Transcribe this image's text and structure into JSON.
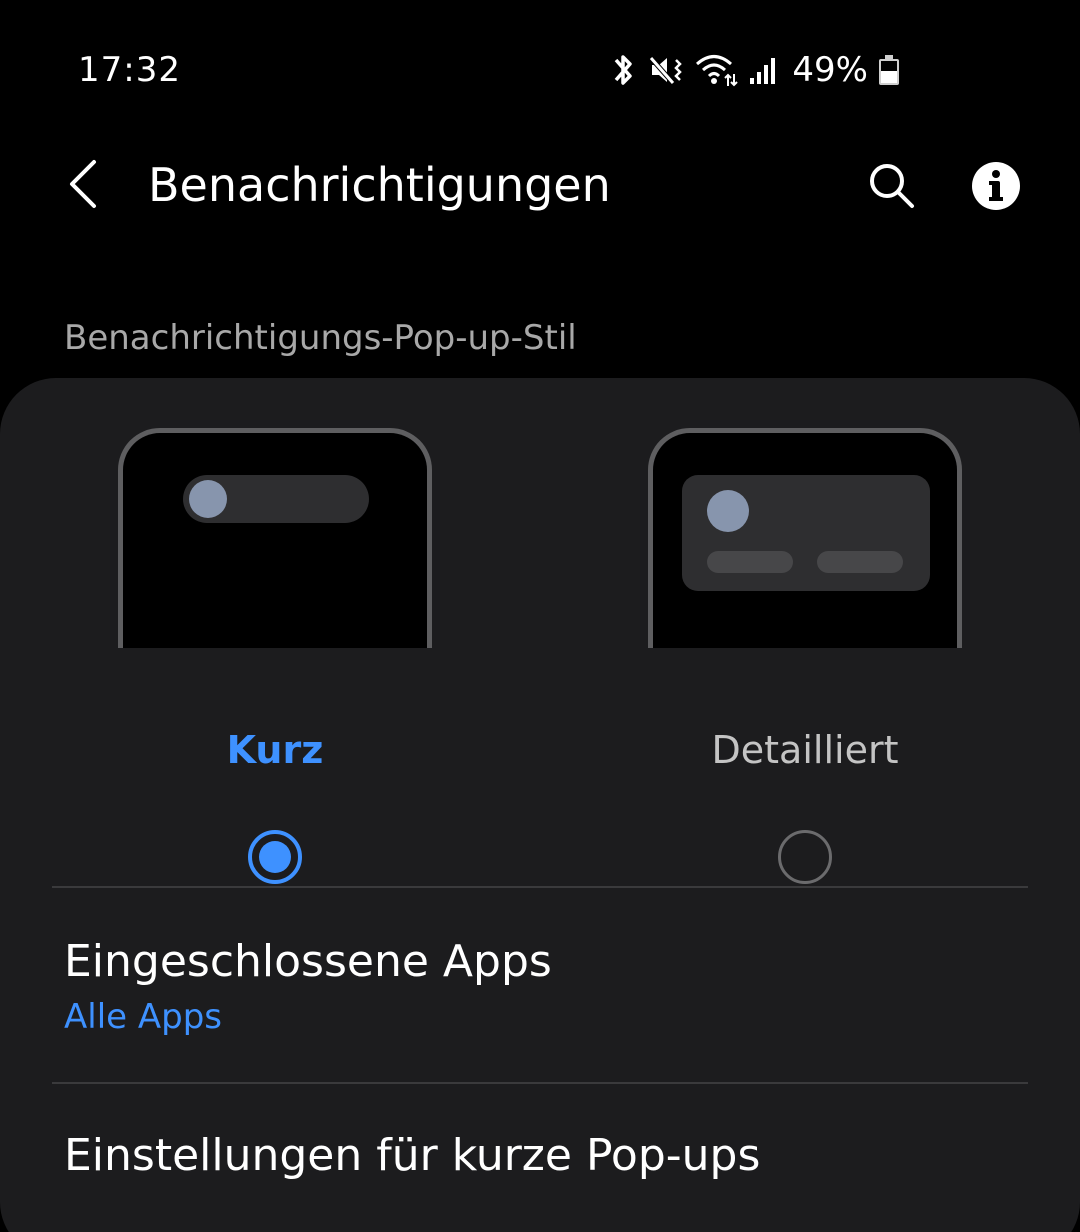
{
  "status_bar": {
    "time": "17:32",
    "battery_percent": "49%",
    "icons": [
      "bluetooth-icon",
      "mute-vibrate-icon",
      "wifi-icon",
      "signal-icon",
      "battery-icon"
    ]
  },
  "app_bar": {
    "title": "Benachrichtigungen",
    "back_icon": "chevron-left-icon",
    "search_icon": "search-icon",
    "info_icon": "info-icon"
  },
  "popup_style": {
    "section_title": "Benachrichtigungs-Pop-up-Stil",
    "options": [
      {
        "label": "Kurz",
        "selected": true
      },
      {
        "label": "Detailliert",
        "selected": false
      }
    ]
  },
  "settings": {
    "included_apps": {
      "title": "Eingeschlossene Apps",
      "value": "Alle Apps"
    },
    "brief_popup_settings": {
      "title": "Einstellungen für kurze Pop-ups"
    }
  },
  "colors": {
    "accent": "#3e91ff",
    "background": "#000000",
    "card": "#1c1c1e",
    "secondary_text": "#a8a8a8"
  }
}
